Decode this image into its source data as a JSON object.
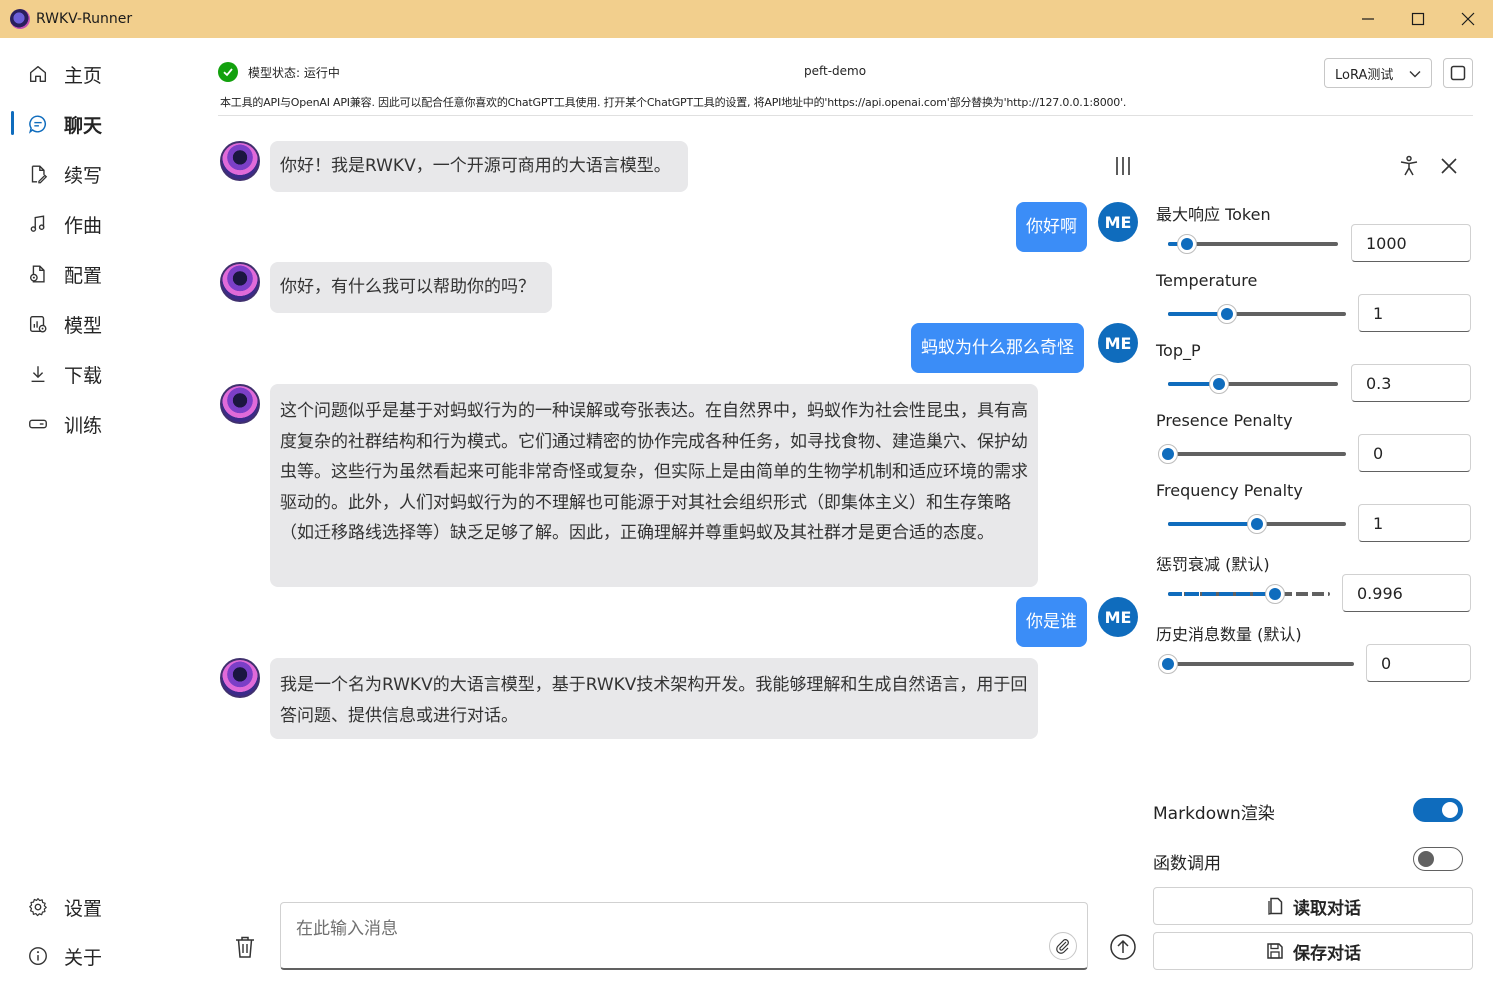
{
  "window": {
    "title": "RWKV-Runner"
  },
  "sidebar": {
    "items": [
      {
        "label": "主页",
        "icon": "home-icon"
      },
      {
        "label": "聊天",
        "icon": "chat-icon"
      },
      {
        "label": "续写",
        "icon": "document-edit-icon"
      },
      {
        "label": "作曲",
        "icon": "music-note-icon"
      },
      {
        "label": "配置",
        "icon": "document-settings-icon"
      },
      {
        "label": "模型",
        "icon": "data-settings-icon"
      },
      {
        "label": "下载",
        "icon": "download-icon"
      },
      {
        "label": "训练",
        "icon": "training-icon"
      }
    ],
    "bottom": [
      {
        "label": "设置",
        "icon": "gear-icon"
      },
      {
        "label": "关于",
        "icon": "info-icon"
      }
    ]
  },
  "header": {
    "status": "模型状态: 运行中",
    "model_name": "peft-demo",
    "lora_value": "LoRA测试",
    "api_note": "本工具的API与OpenAI API兼容. 因此可以配合任意你喜欢的ChatGPT工具使用. 打开某个ChatGPT工具的设置, 将API地址中的'https://api.openai.com'部分替换为'http://127.0.0.1:8000'."
  },
  "chat": {
    "messages": [
      {
        "role": "bot",
        "text": "你好！我是RWKV，一个开源可商用的大语言模型。"
      },
      {
        "role": "user",
        "avatar": "ME",
        "text": "你好啊"
      },
      {
        "role": "bot",
        "text": "你好，有什么我可以帮助你的吗？"
      },
      {
        "role": "user",
        "avatar": "ME",
        "text": "蚂蚁为什么那么奇怪"
      },
      {
        "role": "bot",
        "text": "这个问题似乎是基于对蚂蚁行为的一种误解或夸张表达。在自然界中，蚂蚁作为社会性昆虫，具有高度复杂的社群结构和行为模式。它们通过精密的协作完成各种任务，如寻找食物、建造巢穴、保护幼虫等。这些行为虽然看起来可能非常奇怪或复杂，但实际上是由简单的生物学机制和适应环境的需求驱动的。此外，人们对蚂蚁行为的不理解也可能源于对其社会组织形式（即集体主义）和生存策略（如迁移路线选择等）缺乏足够了解。因此，正确理解并尊重蚂蚁及其社群才是更合适的态度。"
      },
      {
        "role": "user",
        "avatar": "ME",
        "text": "你是谁"
      },
      {
        "role": "bot",
        "text": "我是一个名为RWKV的大语言模型，基于RWKV技术架构开发。我能够理解和生成自然语言，用于回答问题、提供信息或进行对话。"
      }
    ],
    "input_placeholder": "在此输入消息"
  },
  "params": [
    {
      "label": "最大响应 Token",
      "value": "1000",
      "level": 0.1
    },
    {
      "label": "Temperature",
      "value": "1",
      "level": 0.33
    },
    {
      "label": "Top_P",
      "value": "0.3",
      "level": 0.3
    },
    {
      "label": "Presence Penalty",
      "value": "0",
      "level": 0.0
    },
    {
      "label": "Frequency Penalty",
      "value": "1",
      "level": 0.5
    },
    {
      "label": "惩罚衰减 (默认)",
      "value": "0.996",
      "level": 0.996
    },
    {
      "label": "历史消息数量 (默认)",
      "value": "0",
      "level": 0.0
    }
  ],
  "toggles": [
    {
      "label": "Markdown渲染",
      "on": true
    },
    {
      "label": "函数调用",
      "on": false
    }
  ],
  "actions": {
    "load_label": "读取对话",
    "save_label": "保存对话"
  },
  "colors": {
    "accent": "#0f6cbd",
    "user_bubble": "#3b8df7",
    "bot_bubble": "#e8e8ea",
    "titlebar": "#f2cf8d",
    "status_ok": "#13a10e"
  }
}
